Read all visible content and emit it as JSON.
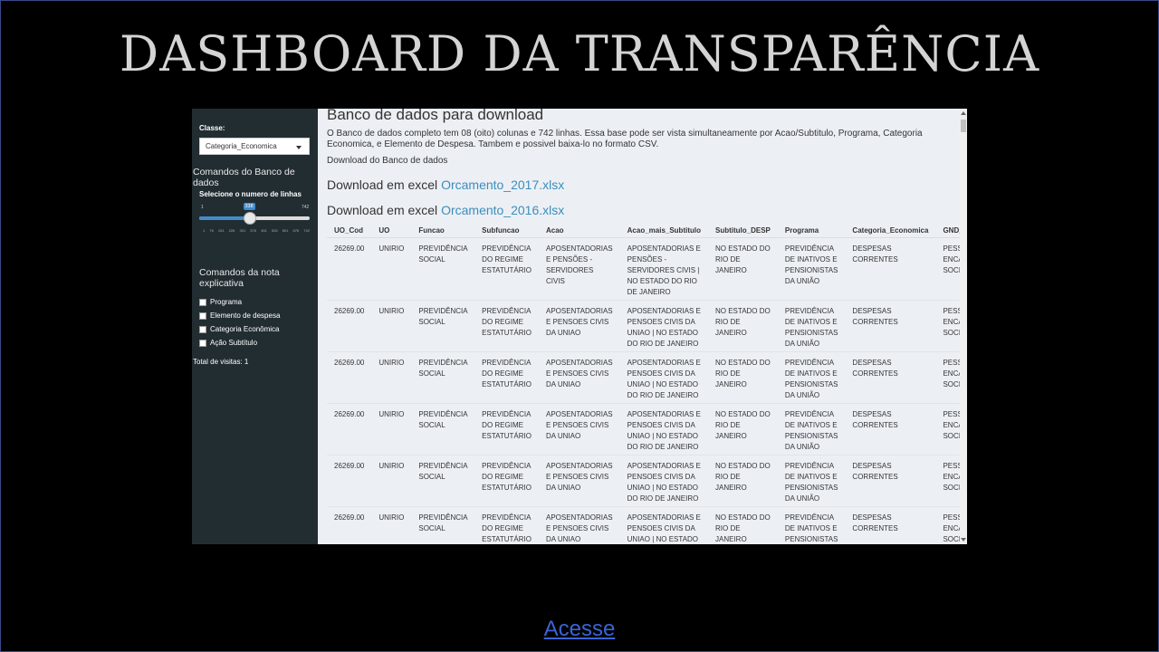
{
  "slide": {
    "title": "Dashboard da Transparência",
    "link_label": "Acesse"
  },
  "sidebar": {
    "classe_label": "Classe:",
    "classe_value": "Categoria_Economica",
    "banco_heading": "Comandos do Banco de dados",
    "slider_label": "Selecione o numero de linhas",
    "slider_min": "1",
    "slider_max": "742",
    "slider_value": "338",
    "slider_fraction": 0.455,
    "slider_ticks": [
      "1",
      "76",
      "151",
      "226",
      "301",
      "376",
      "451",
      "526",
      "601",
      "676",
      "742"
    ],
    "nota_heading": "Comandos da nota explicativa",
    "checkboxes": [
      "Programa",
      "Elemento de despesa",
      "Categoria Econômica",
      "Ação Subtítulo"
    ],
    "visits": "Total de visitas: 1"
  },
  "main": {
    "title": "Banco de dados para download",
    "description": "O Banco de dados completo tem 08 (oito) colunas e 742 linhas. Essa base pode ser vista simultaneamente por Acao/Subtitulo, Programa, Categoria Economica, e Elemento de Despesa. Tambem e possivel baixa-lo no formato CSV.",
    "download_heading": "Download do Banco de dados",
    "downloads": [
      {
        "prefix": "Download em excel ",
        "link": "Orcamento_2017.xlsx"
      },
      {
        "prefix": "Download em excel ",
        "link": "Orcamento_2016.xlsx"
      }
    ]
  },
  "table": {
    "columns": [
      "UO_Cod",
      "UO",
      "Funcao",
      "Subfuncao",
      "Acao",
      "Acao_mais_Subtitulo",
      "Subtitulo_DESP",
      "Programa",
      "Categoria_Economica",
      "GND_DESP"
    ],
    "rows": [
      [
        "26269.00",
        "UNIRIO",
        "PREVIDÊNCIA SOCIAL",
        "PREVIDÊNCIA DO REGIME ESTATUTÁRIO",
        "APOSENTADORIAS E PENSÕES - SERVIDORES CIVIS",
        "APOSENTADORIAS E PENSÕES - SERVIDORES CIVIS | NO ESTADO DO RIO DE JANEIRO",
        "NO ESTADO DO RIO DE JANEIRO",
        "PREVIDÊNCIA DE INATIVOS E PENSIONISTAS DA UNIÃO",
        "DESPESAS CORRENTES",
        "PESSOAL E ENCARGOS SOCIAIS"
      ],
      [
        "26269.00",
        "UNIRIO",
        "PREVIDÊNCIA SOCIAL",
        "PREVIDÊNCIA DO REGIME ESTATUTÁRIO",
        "APOSENTADORIAS E PENSOES CIVIS DA UNIAO",
        "APOSENTADORIAS E PENSOES CIVIS DA UNIAO | NO ESTADO DO RIO DE JANEIRO",
        "NO ESTADO DO RIO DE JANEIRO",
        "PREVIDÊNCIA DE INATIVOS E PENSIONISTAS DA UNIÃO",
        "DESPESAS CORRENTES",
        "PESSOAL E ENCARGOS SOCIAIS"
      ],
      [
        "26269.00",
        "UNIRIO",
        "PREVIDÊNCIA SOCIAL",
        "PREVIDÊNCIA DO REGIME ESTATUTÁRIO",
        "APOSENTADORIAS E PENSOES CIVIS DA UNIAO",
        "APOSENTADORIAS E PENSOES CIVIS DA UNIAO | NO ESTADO DO RIO DE JANEIRO",
        "NO ESTADO DO RIO DE JANEIRO",
        "PREVIDÊNCIA DE INATIVOS E PENSIONISTAS DA UNIÃO",
        "DESPESAS CORRENTES",
        "PESSOAL E ENCARGOS SOCIAIS"
      ],
      [
        "26269.00",
        "UNIRIO",
        "PREVIDÊNCIA SOCIAL",
        "PREVIDÊNCIA DO REGIME ESTATUTÁRIO",
        "APOSENTADORIAS E PENSOES CIVIS DA UNIAO",
        "APOSENTADORIAS E PENSOES CIVIS DA UNIAO | NO ESTADO DO RIO DE JANEIRO",
        "NO ESTADO DO RIO DE JANEIRO",
        "PREVIDÊNCIA DE INATIVOS E PENSIONISTAS DA UNIÃO",
        "DESPESAS CORRENTES",
        "PESSOAL E ENCARGOS SOCIAIS"
      ],
      [
        "26269.00",
        "UNIRIO",
        "PREVIDÊNCIA SOCIAL",
        "PREVIDÊNCIA DO REGIME ESTATUTÁRIO",
        "APOSENTADORIAS E PENSOES CIVIS DA UNIAO",
        "APOSENTADORIAS E PENSOES CIVIS DA UNIAO | NO ESTADO DO RIO DE JANEIRO",
        "NO ESTADO DO RIO DE JANEIRO",
        "PREVIDÊNCIA DE INATIVOS E PENSIONISTAS DA UNIÃO",
        "DESPESAS CORRENTES",
        "PESSOAL E ENCARGOS SOCIAIS"
      ],
      [
        "26269.00",
        "UNIRIO",
        "PREVIDÊNCIA SOCIAL",
        "PREVIDÊNCIA DO REGIME ESTATUTÁRIO",
        "APOSENTADORIAS E PENSOES CIVIS DA UNIAO",
        "APOSENTADORIAS E PENSOES CIVIS DA UNIAO | NO ESTADO DO RIO DE JANEIRO",
        "NO ESTADO DO RIO DE JANEIRO",
        "PREVIDÊNCIA DE INATIVOS E PENSIONISTAS DA UNIÃO",
        "DESPESAS CORRENTES",
        "PESSOAL E ENCARGOS SOCIAIS"
      ]
    ],
    "column_widths": [
      46,
      40,
      62,
      73,
      81,
      94,
      74,
      69,
      96,
      54
    ]
  },
  "colors": {
    "sidebar_bg": "#222d32",
    "content_bg": "#ecf0f5",
    "link": "#3c8dbc",
    "slider_accent": "#428bca",
    "slide_bg": "#000000",
    "title_text": "#d4d4d4",
    "acesse_link": "#3a64d6"
  }
}
